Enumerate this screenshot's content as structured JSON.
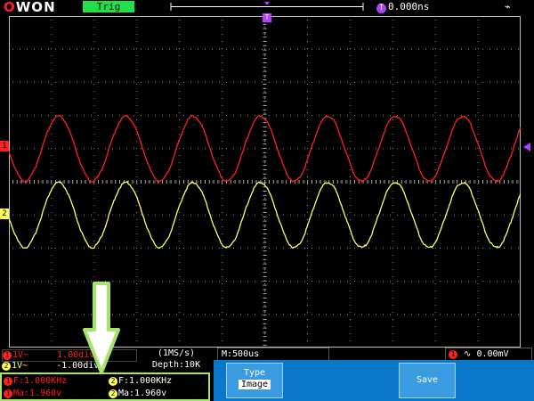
{
  "header": {
    "logo_o": "O",
    "logo_rest": "WON",
    "trigger_status": "Trig",
    "time_position": "0.000ns",
    "time_badge": "T"
  },
  "markers": {
    "ch1": "1",
    "ch2": "2",
    "trigger_top": "T"
  },
  "channel_info": {
    "ch1": {
      "badge": "1",
      "coupling": "1V~",
      "position": "1.00div"
    },
    "ch2": {
      "badge": "2",
      "coupling": "1V~",
      "position": "-1.00div"
    }
  },
  "acquisition": {
    "rate": "(1MS/s)",
    "depth": "Depth:10K"
  },
  "timebase": "M:500us",
  "trigger": {
    "badge": "1",
    "slope": "∿",
    "level": "0.00mV"
  },
  "measurements": {
    "ch1_freq": "F:1.000KHz",
    "ch2_freq": "F:1.000KHz",
    "ch1_ma": "Ma:1.960v",
    "ch2_ma": "Ma:1.960v",
    "badge1": "1",
    "badge2": "2"
  },
  "menu": {
    "type_label": "Type",
    "type_value": "Image",
    "save_label": "Save"
  },
  "colors": {
    "ch1": "#ff2020",
    "ch2": "#ffff60",
    "trigger": "#b040ff",
    "status_ok": "#22e04a",
    "menu_bg": "#0a78c8",
    "highlight": "#a6e36a"
  },
  "waveform": {
    "ch1": {
      "type": "sine",
      "frequency_hz": 1000,
      "amplitude_v": 1.96
    },
    "ch2": {
      "type": "sine",
      "frequency_hz": 1000,
      "amplitude_v": 1.96
    }
  }
}
